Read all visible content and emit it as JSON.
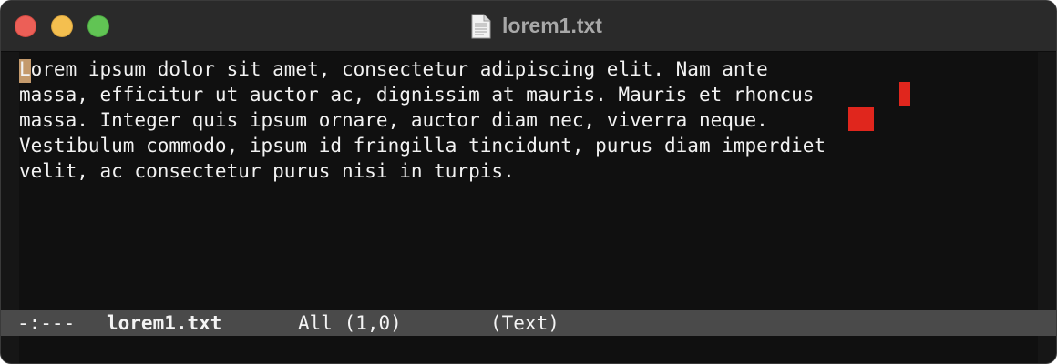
{
  "window": {
    "title": "lorem1.txt",
    "icon": "text-document-icon"
  },
  "editor": {
    "lines": [
      "Lorem ipsum dolor sit amet, consectetur adipiscing elit. Nam ante",
      "massa, efficitur ut auctor ac, dignissim at mauris. Mauris et rhoncus",
      "massa. Integer quis ipsum ornare, auctor diam nec, viverra neque.",
      "Vestibulum commodo, ipsum id fringilla tincidunt, purus diam imperdiet",
      "velit, ac consectetur purus nisi in turpis."
    ]
  },
  "modeline": {
    "status": "-:---",
    "buffer": "lorem1.txt",
    "position": "All (1,0)",
    "mode": "(Text)"
  },
  "colors": {
    "background": "#101010",
    "text": "#f2f2f2",
    "cursor": "#c49a6c",
    "trailing_whitespace": "#e0261d",
    "modeline": "#4a4a4a"
  }
}
